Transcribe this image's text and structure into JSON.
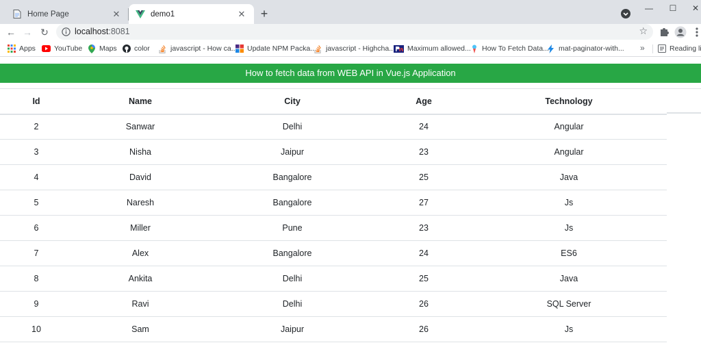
{
  "browser": {
    "tabs": [
      {
        "title": "Home Page",
        "favicon": "page-icon",
        "active": false
      },
      {
        "title": "demo1",
        "favicon": "vue-logo-icon",
        "active": true
      }
    ],
    "url_host": "localhost",
    "url_port": ":8081",
    "bookmarks": [
      {
        "label": "Apps",
        "icon": "apps-grid-icon"
      },
      {
        "label": "YouTube",
        "icon": "youtube-icon"
      },
      {
        "label": "Maps",
        "icon": "maps-pin-icon"
      },
      {
        "label": "color",
        "icon": "github-icon"
      },
      {
        "label": "javascript - How ca...",
        "icon": "stackoverflow-icon"
      },
      {
        "label": "Update NPM Packa...",
        "icon": "grid-colorful-icon"
      },
      {
        "label": "javascript - Highcha...",
        "icon": "stackoverflow-icon"
      },
      {
        "label": "Maximum allowed...",
        "icon": "pin-logo-icon"
      },
      {
        "label": "How To Fetch Data...",
        "icon": "bookmark-page-icon"
      },
      {
        "label": "mat-paginator-with...",
        "icon": "bolt-icon"
      }
    ],
    "reading_list": "Reading list"
  },
  "page": {
    "banner_title": "How to fetch data from WEB API in Vue.js Application",
    "columns": [
      "Id",
      "Name",
      "City",
      "Age",
      "Technology"
    ],
    "rows": [
      [
        "2",
        "Sanwar",
        "Delhi",
        "24",
        "Angular"
      ],
      [
        "3",
        "Nisha",
        "Jaipur",
        "23",
        "Angular"
      ],
      [
        "4",
        "David",
        "Bangalore",
        "25",
        "Java"
      ],
      [
        "5",
        "Naresh",
        "Bangalore",
        "27",
        "Js"
      ],
      [
        "6",
        "Miller",
        "Pune",
        "23",
        "Js"
      ],
      [
        "7",
        "Alex",
        "Bangalore",
        "24",
        "ES6"
      ],
      [
        "8",
        "Ankita",
        "Delhi",
        "25",
        "Java"
      ],
      [
        "9",
        "Ravi",
        "Delhi",
        "26",
        "SQL Server"
      ],
      [
        "10",
        "Sam",
        "Jaipur",
        "26",
        "Js"
      ]
    ]
  },
  "colors": {
    "banner_green": "#28a745",
    "tabstrip": "#dee1e6",
    "table_border": "#dee2e6"
  }
}
